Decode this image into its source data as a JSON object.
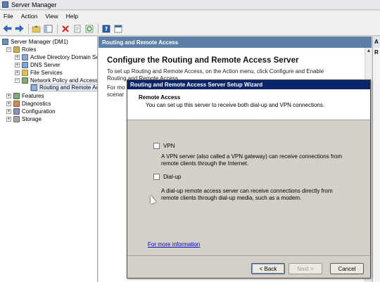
{
  "window": {
    "title": "Server Manager"
  },
  "menu": [
    "File",
    "Action",
    "View",
    "Help"
  ],
  "toolbar": {
    "icons": [
      "back-icon",
      "forward-icon",
      "up-icon",
      "show-hide-tree-icon",
      "delete-icon",
      "properties-icon",
      "refresh-icon",
      "help-icon",
      "console-icon"
    ]
  },
  "tree": {
    "root": "Server Manager (DM1)",
    "roles": "Roles",
    "ad": "Active Directory Domain Se",
    "dns": "DNS Server",
    "fs": "File Services",
    "np": "Network Policy and Access",
    "rr": "Routing and Remote Ac",
    "features": "Features",
    "diagnostics": "Diagnostics",
    "configuration": "Configuration",
    "storage": "Storage"
  },
  "content": {
    "header": "Routing and Remote Access",
    "heading": "Configure the Routing and Remote Access Server",
    "para_line1": "To set up Routing and Remote Access, on the Action menu, click Configure and Enable",
    "para_line2": "Routing and Remote Access.",
    "para2_line1": "For mo",
    "para2_line2": "scenar"
  },
  "actions": {
    "header": "A",
    "row": "R"
  },
  "wizard": {
    "title": "Routing and Remote Access Server Setup Wizard",
    "section_title": "Remote Access",
    "section_subtitle": "You can set up this server to receive both dial-up and VPN connections.",
    "vpn_label": "VPN",
    "vpn_checked": false,
    "vpn_desc_line1": "A VPN server (also called a VPN gateway) can receive connections from",
    "vpn_desc_line2": "remote clients through the Internet.",
    "dialup_label": "Dial-up",
    "dialup_checked": false,
    "dialup_desc_line1": "A dial-up remote access server can receive connections directly from",
    "dialup_desc_line2": "remote clients through dial-up media, such as a modem.",
    "more_info": "For more information",
    "back_label": "< Back",
    "next_label": "Next >",
    "cancel_label": "Cancel"
  }
}
